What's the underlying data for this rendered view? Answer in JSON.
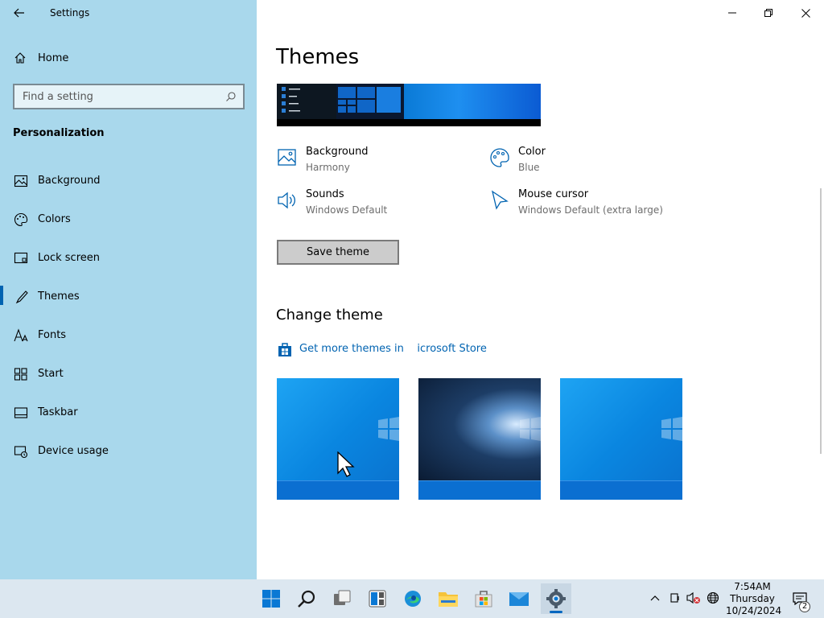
{
  "app": {
    "title": "Settings"
  },
  "sidebar": {
    "home_label": "Home",
    "search_placeholder": "Find a setting",
    "section_title": "Personalization",
    "items": [
      {
        "label": "Background",
        "icon": "image-icon"
      },
      {
        "label": "Colors",
        "icon": "palette-icon"
      },
      {
        "label": "Lock screen",
        "icon": "lock-screen-icon"
      },
      {
        "label": "Themes",
        "icon": "brush-icon",
        "active": true
      },
      {
        "label": "Fonts",
        "icon": "font-icon"
      },
      {
        "label": "Start",
        "icon": "start-grid-icon"
      },
      {
        "label": "Taskbar",
        "icon": "taskbar-icon"
      },
      {
        "label": "Device usage",
        "icon": "device-usage-icon"
      }
    ]
  },
  "main": {
    "title": "Themes",
    "props": {
      "background": {
        "label": "Background",
        "value": "Harmony"
      },
      "color": {
        "label": "Color",
        "value": "Blue"
      },
      "sounds": {
        "label": "Sounds",
        "value": "Windows Default"
      },
      "cursor": {
        "label": "Mouse cursor",
        "value": "Windows Default (extra large)"
      }
    },
    "save_button": "Save theme",
    "change_theme_title": "Change theme",
    "store_link": "Get more themes in    icrosoft Store",
    "themes": [
      "windows-light-theme",
      "windows-dark-theme",
      "windows-theme"
    ]
  },
  "taskbar": {
    "apps": [
      "start-icon",
      "search-icon",
      "task-view-icon",
      "widgets-icon",
      "edge-icon",
      "file-explorer-icon",
      "store-icon",
      "mail-icon",
      "settings-icon"
    ],
    "time": "7:54AM",
    "day": "Thursday",
    "date": "10/24/2024",
    "notification_count": "2"
  },
  "colors": {
    "sidebar_bg": "#a9d8ec",
    "accent": "#0063b1",
    "taskbar_bg": "#dce7f0"
  }
}
